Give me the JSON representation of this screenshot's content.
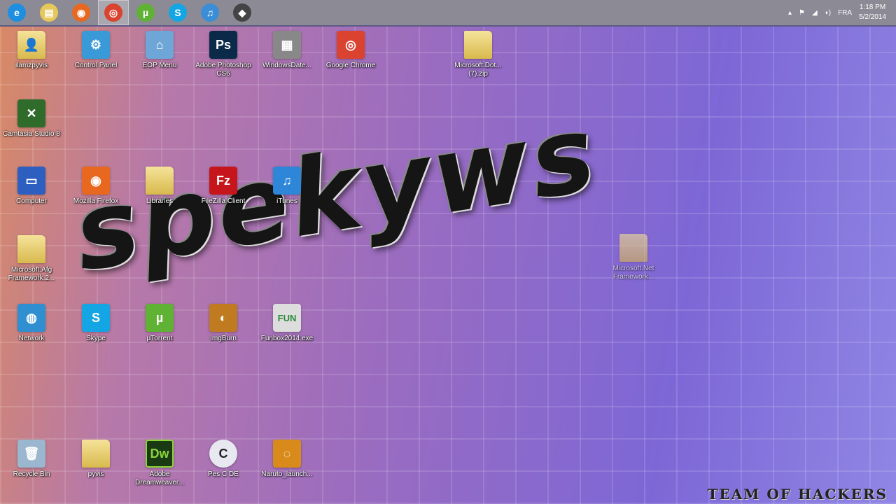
{
  "taskbar": {
    "apps": [
      {
        "name": "internet-explorer",
        "glyph": "e",
        "color": "#1e8ee0"
      },
      {
        "name": "file-explorer",
        "glyph": "▤",
        "color": "#e6c75a"
      },
      {
        "name": "firefox",
        "glyph": "◉",
        "color": "#e8681f"
      },
      {
        "name": "chrome",
        "glyph": "◎",
        "color": "#d9432f",
        "active": true
      },
      {
        "name": "utorrent",
        "glyph": "µ",
        "color": "#5fb233"
      },
      {
        "name": "skype",
        "glyph": "S",
        "color": "#14a6e4"
      },
      {
        "name": "itunes",
        "glyph": "♫",
        "color": "#3b8ed6"
      },
      {
        "name": "app",
        "glyph": "◆",
        "color": "#444"
      }
    ],
    "tray": {
      "language": "FRA",
      "time": "1:18 PM",
      "date": "5/2/2014"
    }
  },
  "desktop": {
    "icons": [
      {
        "label": "ilamzpyvis",
        "glyph": "👤",
        "type": "folder"
      },
      {
        "label": "Control Panel",
        "glyph": "⚙",
        "color": "#3a9ad8"
      },
      {
        "label": "EOP Menu",
        "glyph": "⌂",
        "color": "#6fa6d8"
      },
      {
        "label": "Adobe Photoshop CS6",
        "glyph": "Ps",
        "color": "#0b2a4a"
      },
      {
        "label": "WindowsDate...",
        "glyph": "▦",
        "color": "#888"
      },
      {
        "label": "Google Chrome",
        "glyph": "◎",
        "color": "#d9432f"
      },
      {
        "label": "Microsoft.Dot... (7).zip",
        "glyph": "",
        "type": "folder"
      },
      {
        "label": "Camtasia Studio 8",
        "glyph": "✕",
        "color": "#2f6b2a"
      },
      {
        "label": "Computer",
        "glyph": "▭",
        "color": "#2c5fc0"
      },
      {
        "label": "Mozilla Firefox",
        "glyph": "◉",
        "color": "#e8681f"
      },
      {
        "label": "Libraries",
        "glyph": "",
        "type": "folder"
      },
      {
        "label": "FileZilla Client",
        "glyph": "Fz",
        "color": "#c7161b"
      },
      {
        "label": "iTunes",
        "glyph": "♫",
        "color": "#2e86d8"
      },
      {
        "label": "Microsoft.Afg Framework.2...",
        "glyph": "",
        "type": "folder"
      },
      {
        "label": "Network",
        "glyph": "◍",
        "color": "#2f8fd0"
      },
      {
        "label": "Skype",
        "glyph": "S",
        "color": "#14a6e4"
      },
      {
        "label": "µTorrent",
        "glyph": "µ",
        "color": "#5fb233"
      },
      {
        "label": "ImgBurn",
        "glyph": "◐",
        "color": "#c07a20"
      },
      {
        "label": "Funbox2014.exe",
        "glyph": "FUN",
        "color": "#ddd"
      },
      {
        "label": "Recycle Bin",
        "glyph": "🗑",
        "color": "#9bb6cf"
      },
      {
        "label": "pyvis",
        "glyph": "",
        "type": "folder"
      },
      {
        "label": "Adobe Dreamweaver...",
        "glyph": "Dw",
        "color": "#1a3a14"
      },
      {
        "label": "Pes C DE",
        "glyph": "C",
        "color": "#e8e8f0"
      },
      {
        "label": "Naruto_launch...",
        "glyph": "◌",
        "color": "#d88a1a"
      },
      {
        "label": "Microsoft.Net Framework...",
        "glyph": "",
        "type": "folder"
      }
    ]
  },
  "wallpaper": {
    "logo_text": "spekyws",
    "watermark": "TEAM OF HACKERS"
  }
}
